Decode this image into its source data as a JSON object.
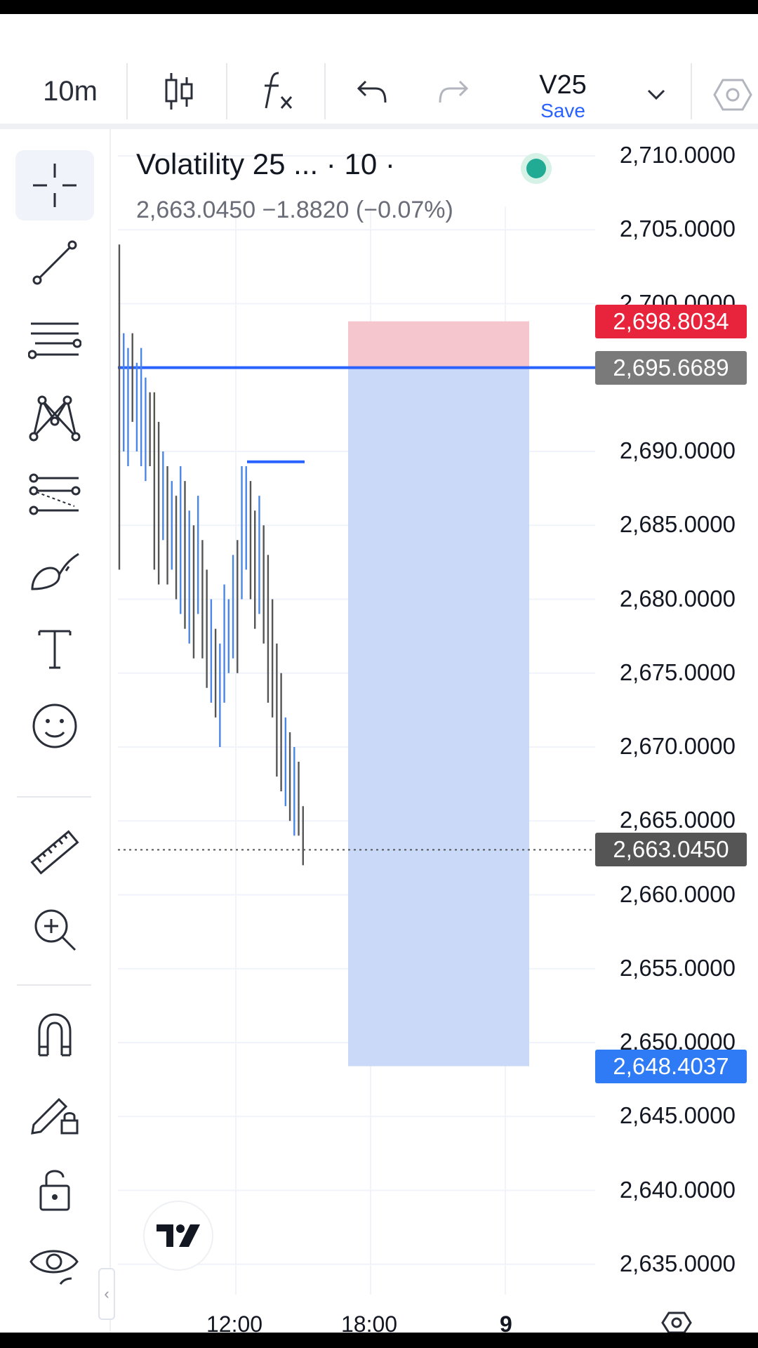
{
  "toolbar": {
    "interval": "10m",
    "layout_name": "V25",
    "save_label": "Save"
  },
  "legend": {
    "title": "Volatility 25 ... · 10 ·",
    "values": "2,663.0450  −1.8820 (−0.07%)"
  },
  "price_axis": {
    "labels": [
      "2,710.0000",
      "2,705.0000",
      "2,700.0000",
      "2,690.0000",
      "2,685.0000",
      "2,680.0000",
      "2,675.0000",
      "2,670.0000",
      "2,665.0000",
      "2,660.0000",
      "2,655.0000",
      "2,650.0000",
      "2,645.0000",
      "2,640.0000",
      "2,635.0000"
    ],
    "badges": {
      "stop": "2,698.8034",
      "entry": "2,695.6689",
      "last": "2,663.0450",
      "target": "2,648.4037"
    }
  },
  "time_axis": {
    "labels": [
      "12:00",
      "18:00",
      "9"
    ]
  },
  "colors": {
    "stop_zone": "#f5c6cd",
    "target_zone": "#c9d9f7",
    "entry_line": "#2962ff",
    "stop_badge": "#e8243c",
    "entry_badge": "#7a7a7a",
    "last_badge": "#555555",
    "target_badge": "#2f7bf5",
    "up_bar": "#4a86e8",
    "down_bar": "#555555"
  },
  "left_tools": [
    {
      "name": "crosshair-icon"
    },
    {
      "name": "trend-line-icon"
    },
    {
      "name": "fib-levels-icon"
    },
    {
      "name": "pattern-icon"
    },
    {
      "name": "forecast-icon"
    },
    {
      "name": "brush-icon"
    },
    {
      "name": "text-icon"
    },
    {
      "name": "emoji-icon"
    },
    {
      "name": "ruler-icon"
    },
    {
      "name": "zoom-in-icon"
    },
    {
      "name": "magnet-icon"
    },
    {
      "name": "lock-drawings-icon"
    },
    {
      "name": "unlock-icon"
    },
    {
      "name": "eye-icon"
    }
  ]
}
